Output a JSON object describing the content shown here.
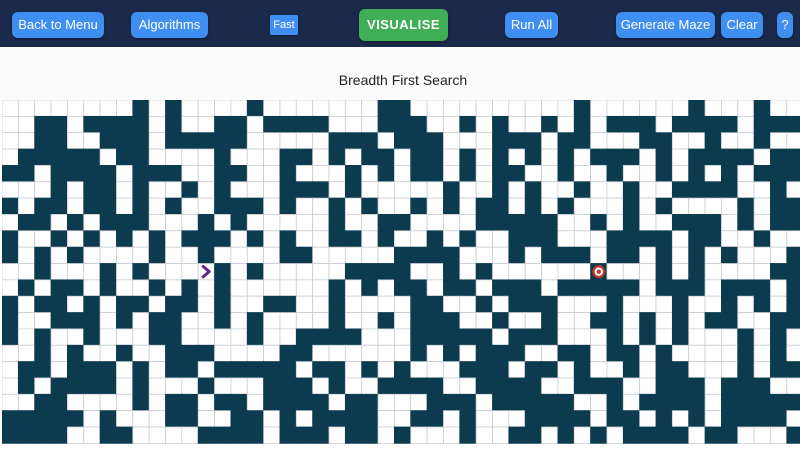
{
  "navbar": {
    "back_to_menu": "Back to Menu",
    "algorithms": "Algorithms",
    "speed": "Fast",
    "visualise": "VISUALISE",
    "run_all": "Run All",
    "generate_maze": "Generate Maze",
    "clear": "Clear",
    "help": "?"
  },
  "header": {
    "algorithm_title": "Breadth First Search"
  },
  "colors": {
    "navbar_bg": "#1b2a4a",
    "button_blue": "#3f8ff2",
    "visualise_green": "#3fae57",
    "wall": "#0c3b50",
    "grid_line": "#c8ccd0",
    "start_node": "#5b2a86",
    "target_node": "#c0392b"
  },
  "icons": {
    "start_node": "chevron-right-icon",
    "target_node": "target-icon"
  },
  "grid": {
    "cols": 49,
    "rows": 21,
    "start": {
      "row": 10,
      "col": 12
    },
    "target": {
      "row": 10,
      "col": 36
    },
    "walls": [
      "........W.W....W.......WW..........W......W...W..",
      "..WW.WWWW.W..WW.WWWW...WWW..W.W..W.W.WWW.WWWW.WWW",
      "..WW..WWW.WWWWW.....WWW.WWW...WWW.WW...WW..W..W..",
      ".WWWWW.WW....W...WW.W.WW.WW.W.W.W.W.WWW.W.WWWW.WW",
      "WW.WWWW.WWW..WW..W...W.W.WW.W.WW..W..W..W.W.W.WWW",
      "...W.WW.W..W.W...WWW.W.....W..W.W..W..W..WWWW..W.",
      "W.WW.WW.W.W..WWW.W..W.W..W.W.WW.W.W...W.W....W.WW",
      ".WW.W.WWW...W.W.....W..WW....WWWWW..W.W..WWW.W.WW",
      "W..W.W.W.W.WWW.W.W..WW.W..W.W..WWW...WWWW.WW..W..",
      "W.W.W....W..W....WW.....WWWW...W.WWW.WW.W.W.W...W",
      "..W...W.W....W.W.....WWWW..W.W......W...W.W....WW",
      ".W.WW.W..W.W.W......W.W.WW.WW.WWW.WWWWW.WWW.WWW.W",
      "W.WW.W.WW.WW.W..WW..W....WW..W.WWW...W...W..W.W.W",
      "W..WWW.W.WW..W.W....W..W.WWW..W..W..WW.W.W.WW..WW",
      "W.W..W...WW....W..WWWW...WWWWW.WWW...W.W.W...W.W.",
      "..W.W..W..WWW....WW......W.W.WWW..WW.WW.W....W.W.",
      ".WW.WWW.W.WW.WWWWW.WW.W.W...WWW.WW.W..W.WW...W.WW",
      ".W.WWWW.W...W...WWW.W..WWWW..WWWW..WWW..WWW.WWW..",
      "..WW....W.WW.WW.WWWW.WW...WWW.WWWWW..W.WWWW.WWWWW",
      "WWWWW.W...WW..WW.W.WWWW..WW.W...WWWW.WW.W.W.WWWW.",
      "WWWW..WW....WWWW.WWW.WW.W...W..WW.W.W.WWWW.WW...W"
    ]
  }
}
